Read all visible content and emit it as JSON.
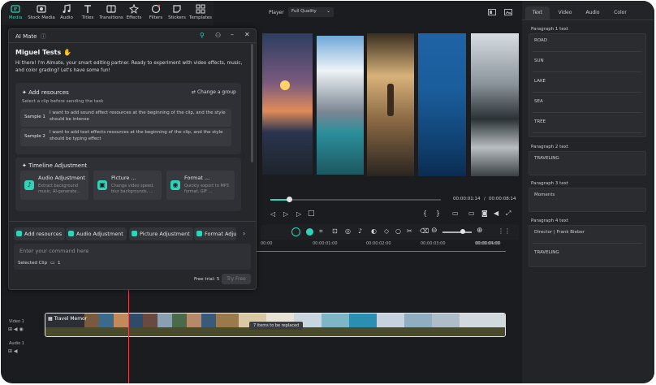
{
  "toolbar": {
    "items": [
      {
        "label": "Media",
        "icon": "media-icon",
        "active": true
      },
      {
        "label": "Stock Media",
        "icon": "stock-media-icon"
      },
      {
        "label": "Audio",
        "icon": "audio-icon"
      },
      {
        "label": "Titles",
        "icon": "titles-icon"
      },
      {
        "label": "Transitions",
        "icon": "transitions-icon"
      },
      {
        "label": "Effects",
        "icon": "effects-icon"
      },
      {
        "label": "Filters",
        "icon": "filters-icon"
      },
      {
        "label": "Stickers",
        "icon": "stickers-icon"
      },
      {
        "label": "Templates",
        "icon": "templates-icon"
      }
    ]
  },
  "player": {
    "label": "Player",
    "quality": "Full Quality",
    "current_time": "00:00:01:14",
    "separator": "/",
    "total_time": "00:00:08:14",
    "progress": 0.11
  },
  "right_panel": {
    "tabs": [
      "Text",
      "Video",
      "Audio",
      "Color"
    ],
    "active_tab": "Text",
    "paragraphs": [
      {
        "title": "Paragraph 1 text",
        "items": [
          "ROAD",
          "SUN",
          "LAKE",
          "SEA",
          "TREE"
        ]
      },
      {
        "title": "Paragraph 2 text",
        "items": [
          "TRAVELING"
        ]
      },
      {
        "title": "Paragraph 3 text",
        "items": [
          "Moments"
        ]
      },
      {
        "title": "Paragraph 4 text",
        "items": [
          "Director | Frank Bieber",
          "TRAVELING"
        ]
      }
    ]
  },
  "aimate": {
    "title": "AI Mate",
    "user_name": "Miguel Tests",
    "greeting": "Hi there! I'm AImate, your smart editing partner. Ready to experiment with video effects, music, and color grading? Let's have some fun!",
    "add_resources": {
      "title": "Add resources",
      "change_label": "Change a group",
      "subtitle": "Select a clip before sending the task",
      "samples": [
        {
          "label": "Sample 1",
          "text": "I want to add sound effect resources at the beginning of the clip, and the style should be intense"
        },
        {
          "label": "Sample 2",
          "text": "I want to add text effects resources at the beginning of the clip, and the style should be typing effect"
        }
      ]
    },
    "timeline_adjustment": {
      "title": "Timeline Adjustment",
      "tiles": [
        {
          "name": "Audio Adjustment",
          "desc": "Extract background music, AI-generate..."
        },
        {
          "name": "Picture ...",
          "desc": "Change video speed, blur backgrounds, ..."
        },
        {
          "name": "Format ...",
          "desc": "Quickly export to MP3 format, GIF ..."
        }
      ]
    },
    "chips": [
      "Add resources",
      "Audio Adjustment",
      "Picture Adjustment",
      "Format Adju"
    ],
    "input_placeholder": "Enter your command here",
    "selected_clip_label": "Selected Clip",
    "selected_clip_count": "1",
    "free_trial": "Free trial: 5",
    "try_free": "Try Free"
  },
  "timeline": {
    "ruler": [
      "00:00",
      "00:00:01:00",
      "00:00:02:00",
      "00:00:03:00",
      "00:00:04:00",
      "00:00:05:00"
    ],
    "tracks": [
      "Video 1",
      "Audio 1"
    ],
    "clip_title": "Travel Memor",
    "replace_badge": "7 items to be replaced"
  },
  "colors": {
    "accent": "#2fd3b8",
    "playhead": "#e2474b"
  }
}
